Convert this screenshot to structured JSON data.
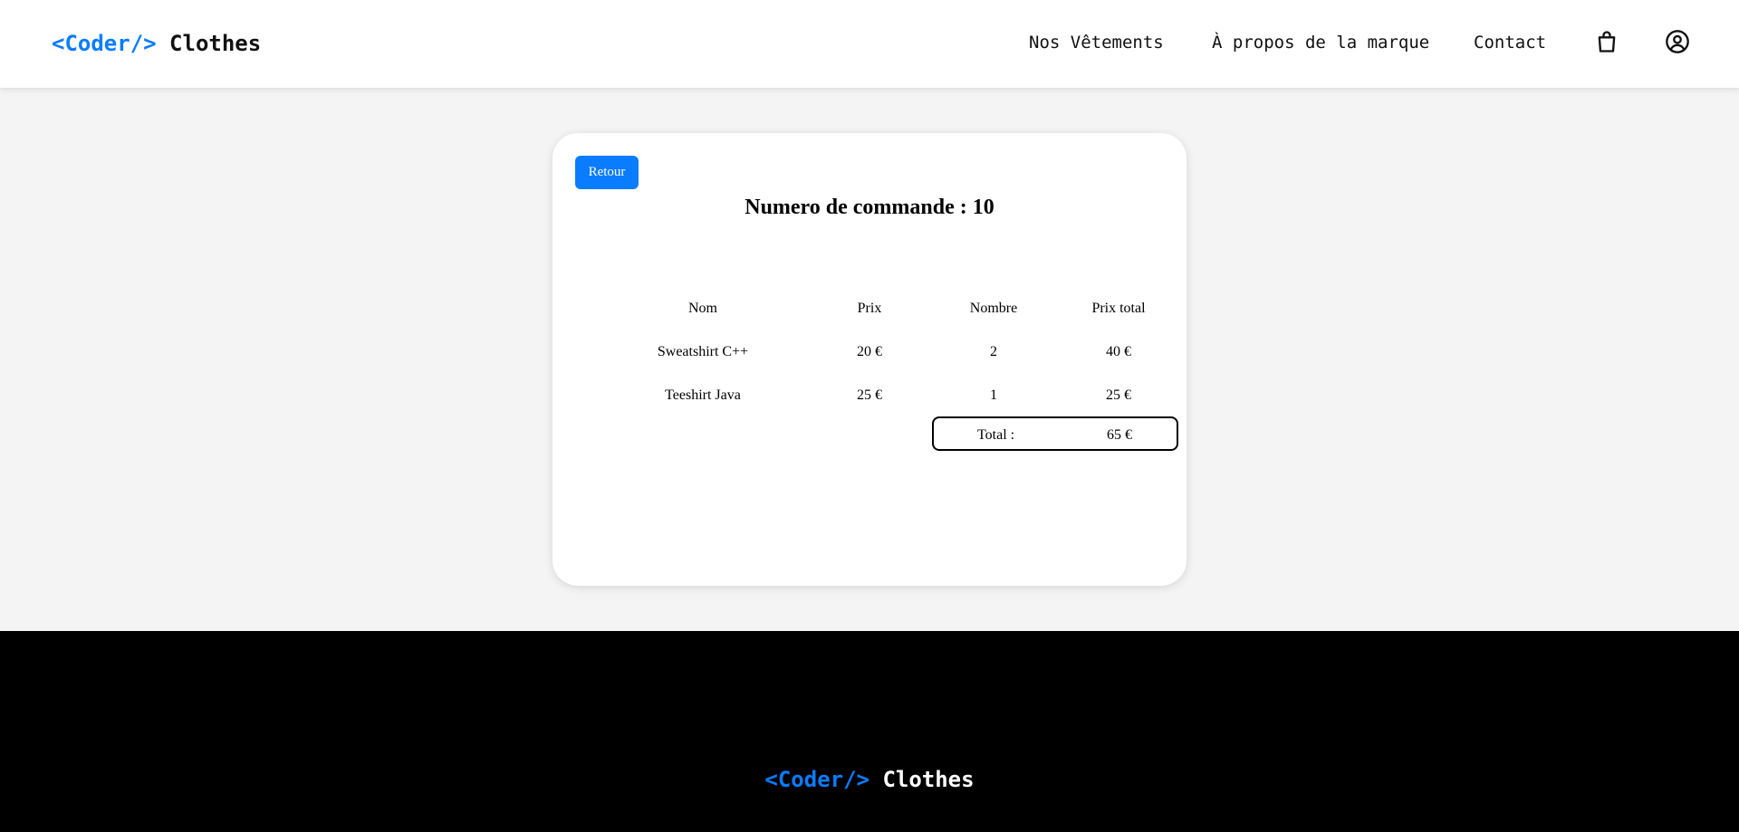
{
  "header": {
    "logo": {
      "brace": "<Coder/>",
      "name": "Clothes"
    },
    "nav": [
      "Nos Vêtements",
      "À propos de la marque",
      "Contact"
    ],
    "icons": [
      "shopping-bag-icon",
      "user-circle-icon"
    ]
  },
  "order": {
    "back_label": "Retour",
    "title": "Numero de commande : 10",
    "columns": [
      "Nom",
      "Prix",
      "Nombre",
      "Prix total"
    ],
    "rows": [
      [
        "Sweatshirt C++",
        "20 €",
        "2",
        "40 €"
      ],
      [
        "Teeshirt Java",
        "25 €",
        "1",
        "25 €"
      ]
    ],
    "total_label": "Total :",
    "total_value": "65 €"
  },
  "footer": {
    "logo": {
      "brace": "<Coder/>",
      "name": "Clothes"
    }
  },
  "colors": {
    "accent": "#0a7cff",
    "footer_bg": "#000000",
    "page_bg": "#f4f4f4"
  }
}
